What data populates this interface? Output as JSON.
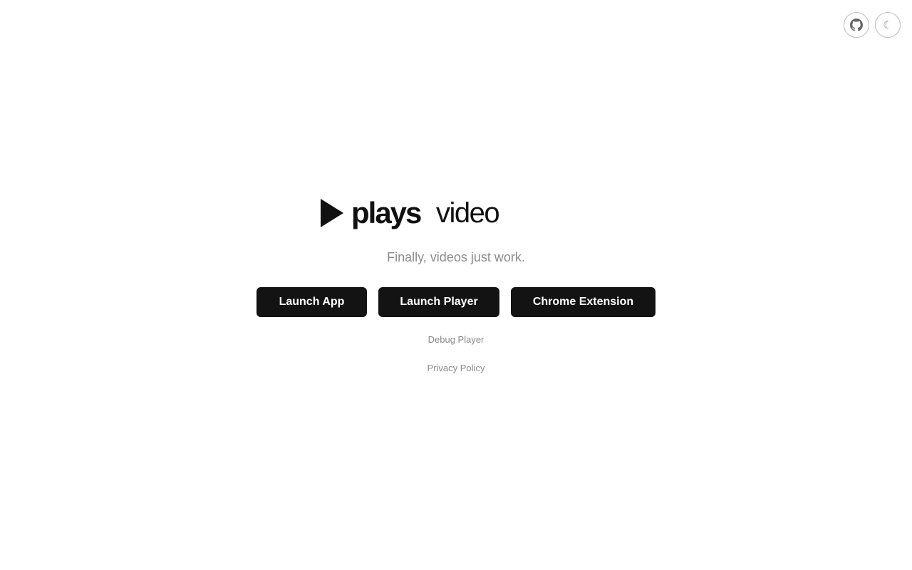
{
  "header": {
    "github_icon": "github-icon",
    "theme_toggle_icon": "moon-icon",
    "theme_toggle_glyph": "☾"
  },
  "logo": {
    "icon": "play-icon",
    "word_bold": "plays",
    "word_light": "video"
  },
  "tagline": "Finally, videos just work.",
  "actions": {
    "launch_app": "Launch App",
    "launch_player": "Launch Player",
    "chrome_extension": "Chrome Extension"
  },
  "links": {
    "debug_player": "Debug Player",
    "privacy_policy": "Privacy Policy"
  },
  "colors": {
    "button_bg": "#131313",
    "button_text": "#ffffff",
    "muted_text": "#8c8c8c",
    "logo_text": "#111111"
  }
}
